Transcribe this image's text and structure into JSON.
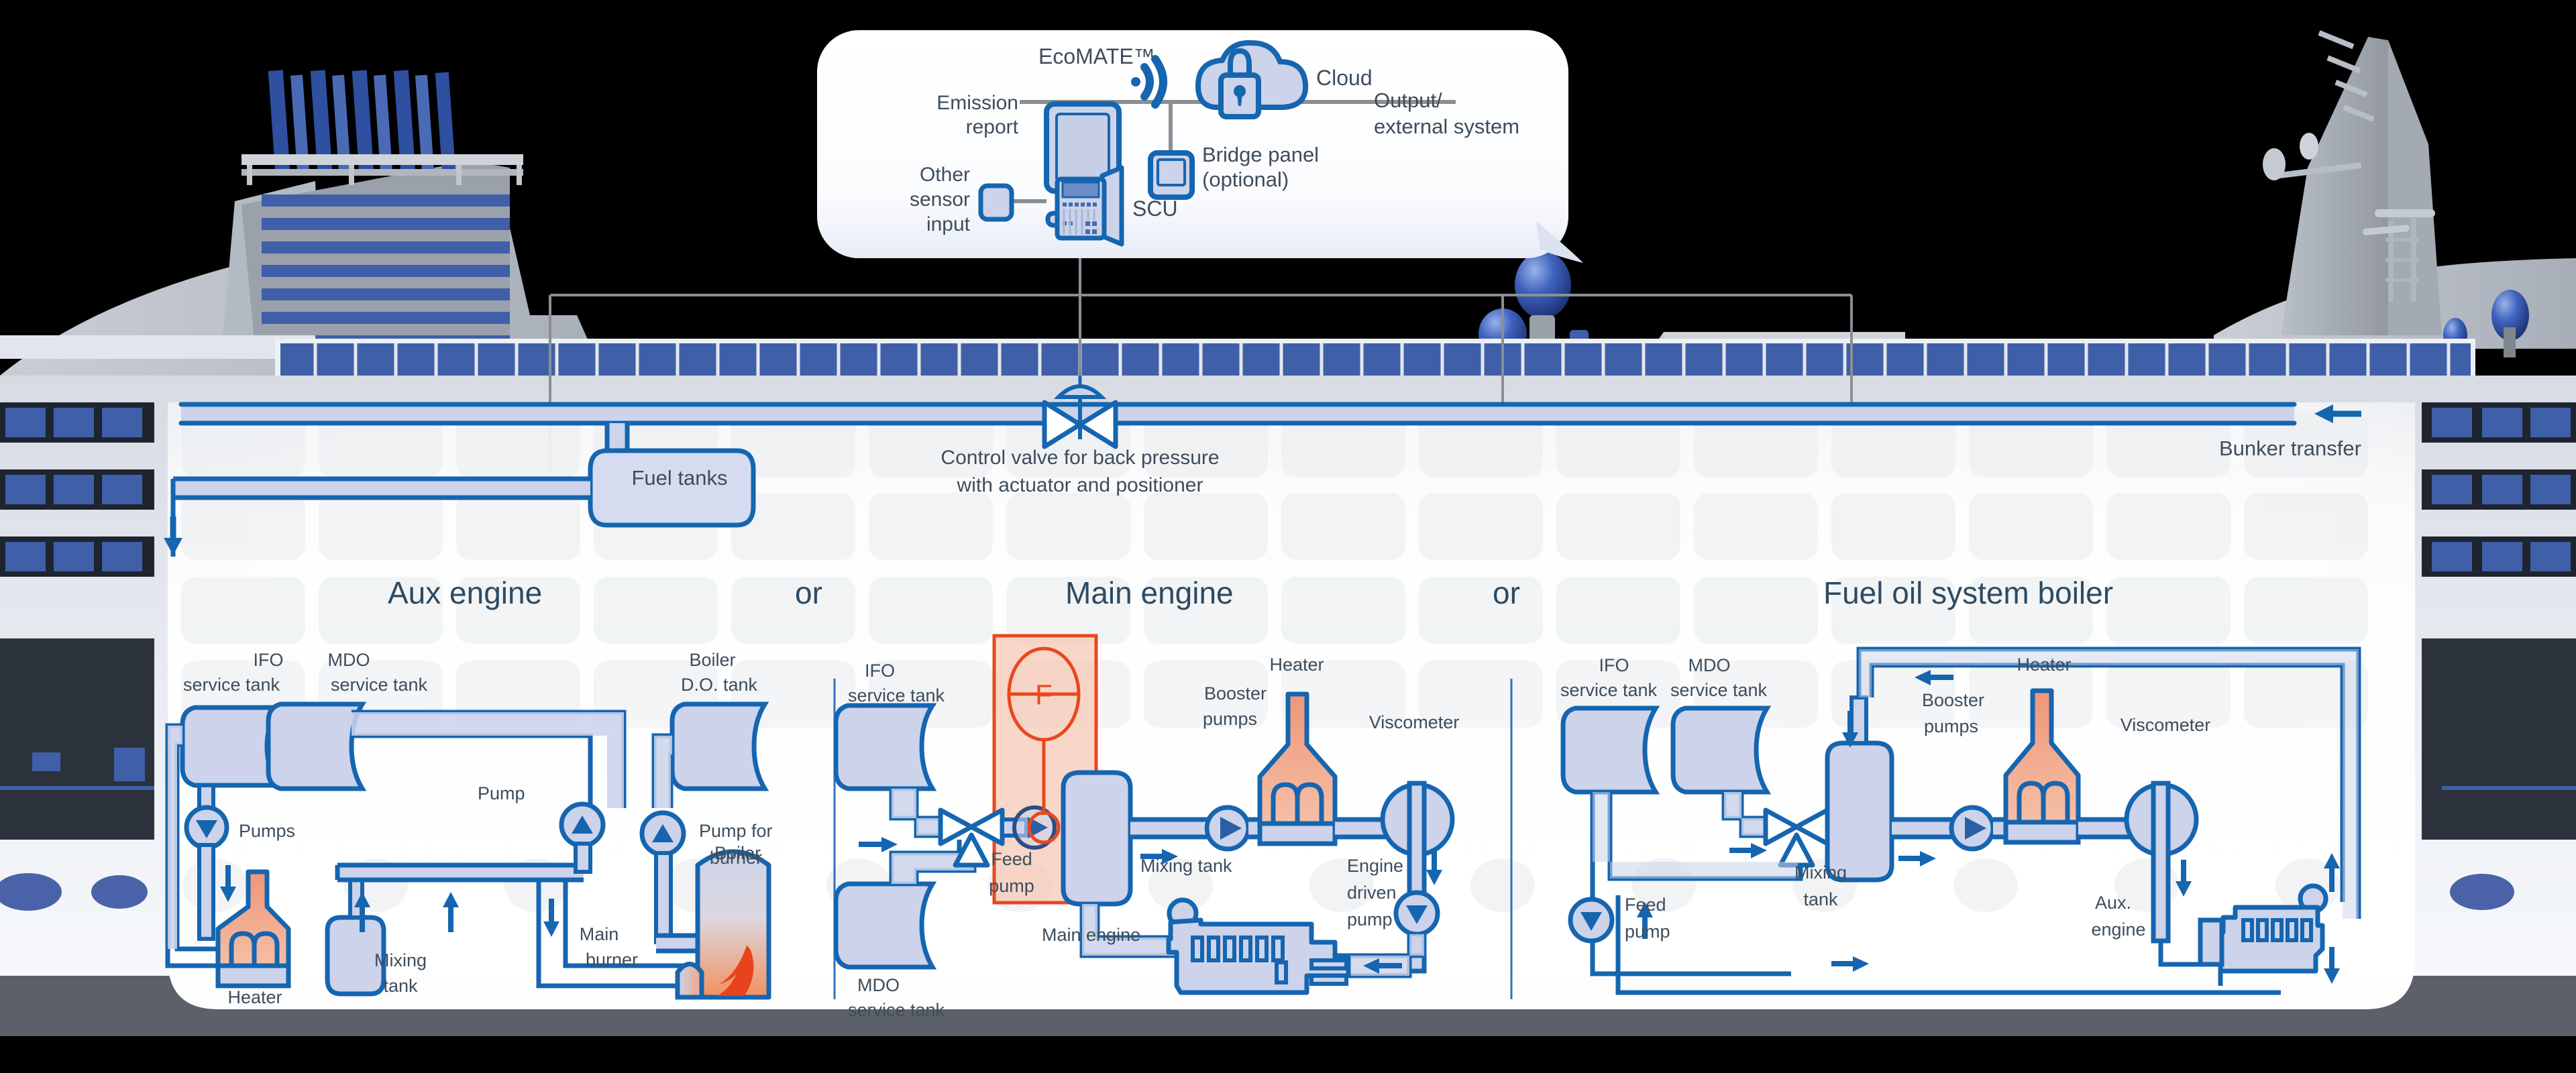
{
  "callout": {
    "title": "EcoMATE™",
    "items": [
      {
        "key": "emission_report",
        "label": "Emission\nreport",
        "icon": "monitor-icon"
      },
      {
        "key": "cloud",
        "label": "Cloud",
        "icon": "cloud-lock-icon"
      },
      {
        "key": "wifi",
        "label": "",
        "icon": "wifi-icon"
      },
      {
        "key": "output_external",
        "label": "Output/\nexternal system",
        "icon": "none"
      },
      {
        "key": "bridge_panel",
        "label": "Bridge panel\n(optional)",
        "icon": "panel-icon"
      },
      {
        "key": "scu",
        "label": "SCU",
        "icon": "scu-cabinet-icon"
      },
      {
        "key": "other_sensor_input",
        "label": "Other\nsensor\ninput",
        "icon": "sensor-box-icon"
      }
    ],
    "emission_report_line1": "Emission",
    "emission_report_line2": "report",
    "cloud_label": "Cloud",
    "output_line1": "Output/",
    "output_line2": "external system",
    "bridge_line1": "Bridge panel",
    "bridge_line2": "(optional)",
    "scu_label": "SCU",
    "sensor_line1": "Other",
    "sensor_line2": "sensor",
    "sensor_line3": "input"
  },
  "top_piping": {
    "fuel_tanks": "Fuel tanks",
    "control_valve_line1": "Control valve for back pressure",
    "control_valve_line2": "with actuator and positioner",
    "bunker_transfer": "Bunker transfer"
  },
  "sections": [
    {
      "id": "aux",
      "title": "Aux engine"
    },
    {
      "id": "or1",
      "title": "or"
    },
    {
      "id": "main",
      "title": "Main engine"
    },
    {
      "id": "or2",
      "title": "or"
    },
    {
      "id": "boiler",
      "title": "Fuel oil system boiler"
    }
  ],
  "aux_engine": {
    "ifo_tank_l1": "IFO",
    "ifo_tank_l2": "service tank",
    "mdo_tank_l1": "MDO",
    "mdo_tank_l2": "service tank",
    "boiler_do_l1": "Boiler",
    "boiler_do_l2": "D.O. tank",
    "pumps": "Pumps",
    "pump": "Pump",
    "pump_burner_l1": "Pump for",
    "pump_burner_l2": "burner",
    "heater": "Heater",
    "mixing_l1": "Mixing",
    "mixing_l2": "tank",
    "main_burner_l1": "Main",
    "main_burner_l2": "burner",
    "boiler": "Boiler"
  },
  "main_engine": {
    "ifo_tank_l1": "IFO",
    "ifo_tank_l2": "service tank",
    "mdo_tank_l1": "MDO",
    "mdo_tank_l2": "service tank",
    "flowmeter_symbol": "F",
    "feed_pump_l1": "Feed",
    "feed_pump_l2": "pump",
    "mixing_tank": "Mixing tank",
    "booster_l1": "Booster",
    "booster_l2": "pumps",
    "heater": "Heater",
    "viscometer": "Viscometer",
    "engine_driven_l1": "Engine",
    "engine_driven_l2": "driven",
    "engine_driven_l3": "pump",
    "main_engine": "Main engine"
  },
  "boiler_system": {
    "ifo_tank_l1": "IFO",
    "ifo_tank_l2": "service tank",
    "mdo_tank_l1": "MDO",
    "mdo_tank_l2": "service tank",
    "mixing_l1": "Mixing",
    "mixing_l2": "tank",
    "booster_l1": "Booster",
    "booster_l2": "pumps",
    "heater": "Heater",
    "viscometer": "Viscometer",
    "feed_pump_l1": "Feed",
    "feed_pump_l2": "pump",
    "aux_engine_l1": "Aux.",
    "aux_engine_l2": "engine"
  },
  "colors": {
    "pipe_stroke": "#1565b0",
    "pipe_fill": "#ccd3ea",
    "label_text": "#3d4d5c",
    "section_text": "#2e4a63",
    "highlight_orange": "#e8481f",
    "highlight_fill": "#f9d0c0",
    "heater_orange": "#ef9677",
    "flame_red": "#e8431c",
    "ship_blue": "#3f5fa8",
    "leader_gray": "#8b8f93"
  }
}
